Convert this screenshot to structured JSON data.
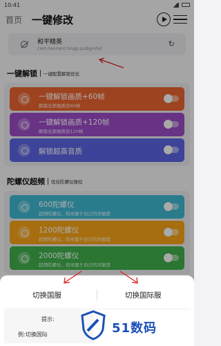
{
  "status_bar": {
    "time": "10:41"
  },
  "header": {
    "home_label": "首页",
    "title": "一键修改",
    "icons": [
      "play-circle-icon",
      "menu-icon"
    ]
  },
  "target_app": {
    "name": "和平精英",
    "package": "com.tencent.tmgp.pubgmhd",
    "icon": "eye-off-icon",
    "refresh_icon": "refresh-icon"
  },
  "unlock_section": {
    "heading": "一键解锁",
    "subtitle": "一键配置解锁优化",
    "items": [
      {
        "title": "一键解锁画质+60帧",
        "desc": "解锁全部画质及60帧",
        "color": "#e8632f",
        "enabled": false
      },
      {
        "title": "一键解锁画质+120帧",
        "desc": "解锁全部画质及120帧",
        "color": "#9a4ac4",
        "enabled": false
      },
      {
        "title": "解锁超高音质",
        "desc": "",
        "color": "#5b63e0",
        "enabled": false
      }
    ]
  },
  "gyro_section": {
    "heading": "陀螺仪超频",
    "subtitle": "优化陀螺仪操控",
    "items": [
      {
        "title": "600陀螺仪",
        "desc": "超频陀螺仪，找寻属于自己的灵敏度",
        "color": "#3fb7cf",
        "enabled": false
      },
      {
        "title": "1200陀螺仪",
        "desc": "超频陀螺仪，找寻属于自己的灵敏度",
        "color": "#f5a216",
        "enabled": false
      },
      {
        "title": "2000陀螺仪",
        "desc": "超频陀螺仪，找寻属于自己的灵敏度",
        "color": "#3fae4a",
        "enabled": false
      }
    ]
  },
  "bottom_sheet": {
    "option_domestic": "切换国服",
    "option_international": "切换国际服",
    "tip_label": "提示:",
    "tip_text": "例:切换国际"
  },
  "watermark": {
    "text": "51数码"
  }
}
